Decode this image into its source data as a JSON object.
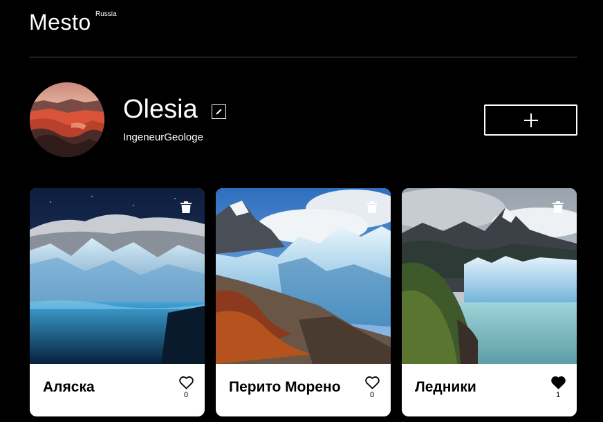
{
  "header": {
    "logo": "Mesto",
    "logo_sup": "Russia"
  },
  "profile": {
    "name": "Olesia",
    "about": "IngeneurGeologe",
    "edit_icon": "pencil-icon",
    "add_icon": "plus-icon"
  },
  "cards": [
    {
      "title": "Аляска",
      "likes": "0",
      "liked": false,
      "like_icon": "heart-outline-icon",
      "delete_icon": "trash-icon"
    },
    {
      "title": "Перито Морено",
      "likes": "0",
      "liked": false,
      "like_icon": "heart-outline-icon",
      "delete_icon": "trash-icon"
    },
    {
      "title": "Ледники",
      "likes": "1",
      "liked": true,
      "like_icon": "heart-filled-icon",
      "delete_icon": "trash-icon"
    }
  ],
  "colors": {
    "background": "#000000",
    "card": "#ffffff",
    "divider": "#545454",
    "text_light": "#ffffff",
    "text_dark": "#000000"
  }
}
